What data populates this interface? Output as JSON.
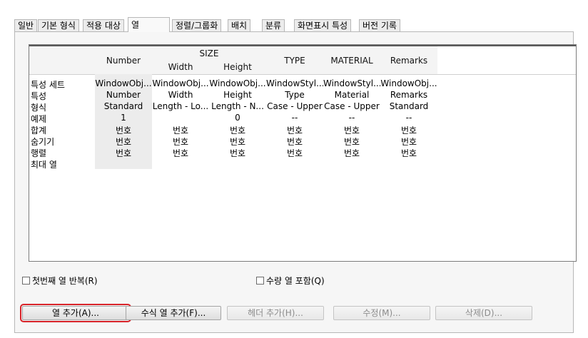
{
  "tabs": [
    {
      "label": "일반"
    },
    {
      "label": "기본 형식"
    },
    {
      "label": "적용 대상"
    },
    {
      "label": "열"
    },
    {
      "label": "정렬/그룹화"
    },
    {
      "label": "배치"
    },
    {
      "label": "분류"
    },
    {
      "label": "화면표시 특성"
    },
    {
      "label": "버전 기록"
    }
  ],
  "active_tab": "열",
  "grid": {
    "headers": {
      "number": "Number",
      "size": "SIZE",
      "width": "Width",
      "height": "Height",
      "type": "TYPE",
      "material": "MATERIAL",
      "remarks": "Remarks"
    },
    "row_labels": [
      "특성 세트",
      "특성",
      "형식",
      "예제",
      "합계",
      "숨기기",
      "행렬",
      "최대 열"
    ],
    "columns": [
      [
        "WindowObj...",
        "Number",
        "Standard",
        "1",
        "번호",
        "번호",
        "번호"
      ],
      [
        "WindowObj...",
        "Width",
        "Length - Lo...",
        "",
        "번호",
        "번호",
        "번호"
      ],
      [
        "WindowObj...",
        "Height",
        "Length - N...",
        "0",
        "번호",
        "번호",
        "번호"
      ],
      [
        "WindowStyl...",
        "Type",
        "Case - Upper",
        "--",
        "번호",
        "번호",
        "번호"
      ],
      [
        "WindowStyl...",
        "Material",
        "Case - Upper",
        "--",
        "번호",
        "번호",
        "번호"
      ],
      [
        "WindowObj...",
        "Remarks",
        "Standard",
        "--",
        "번호",
        "번호",
        "번호"
      ]
    ]
  },
  "options": {
    "repeat_first_col": "첫번째 열 반복(R)",
    "include_qty_col": "수량 열 포함(Q)"
  },
  "buttons": {
    "add_column": "열 추가(A)...",
    "add_formula_column": "수식 열 추가(F)...",
    "add_header": "헤더 추가(H)...",
    "modify": "수정(M)...",
    "delete": "삭제(D)..."
  },
  "colors": {
    "focus_outline": "#d8242a",
    "grid_border": "#7c7c7c"
  }
}
